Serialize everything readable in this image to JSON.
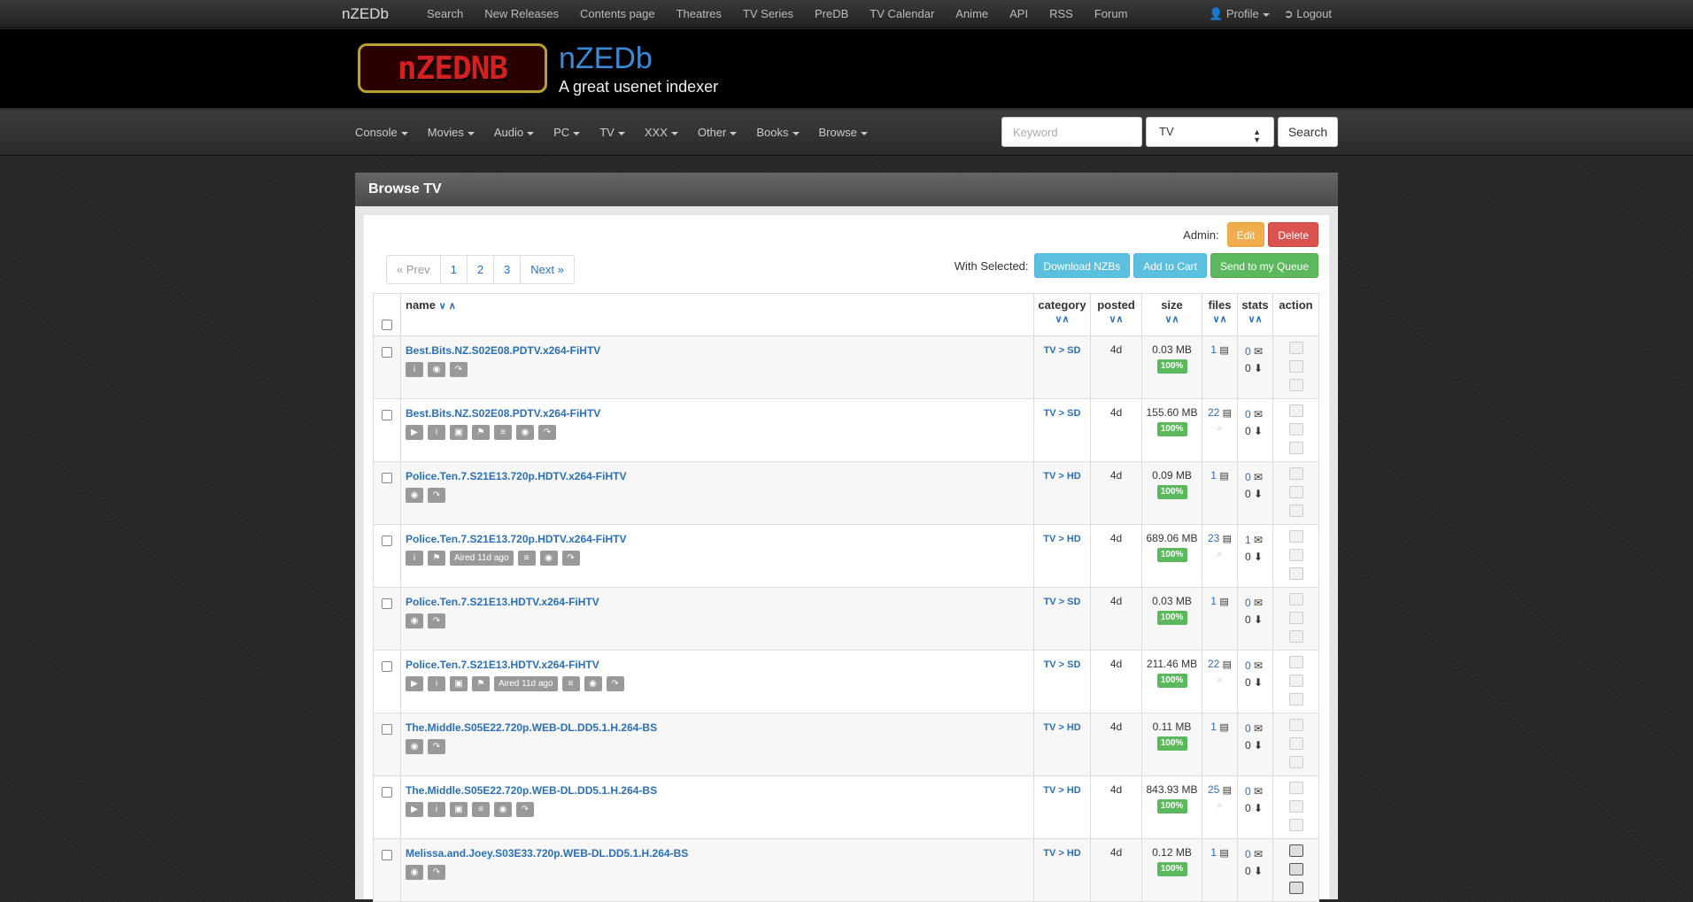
{
  "topnav": {
    "brand": "nZEDb",
    "links": [
      "Search",
      "New Releases",
      "Contents page",
      "Theatres",
      "TV Series",
      "PreDB",
      "TV Calendar",
      "Anime",
      "API",
      "RSS",
      "Forum"
    ],
    "profile": "Profile",
    "logout": "Logout"
  },
  "header": {
    "logo_text": "nZEDNB",
    "title": "nZEDb",
    "subtitle": "A great usenet indexer"
  },
  "catnav": {
    "items": [
      "Console",
      "Movies",
      "Audio",
      "PC",
      "TV",
      "XXX",
      "Other",
      "Books",
      "Browse"
    ],
    "search_placeholder": "Keyword",
    "search_category": "TV",
    "search_button": "Search"
  },
  "panel": {
    "title": "Browse TV",
    "admin_label": "Admin:",
    "edit_label": "Edit",
    "delete_label": "Delete",
    "with_selected_label": "With Selected:",
    "download_label": "Download NZBs",
    "cart_label": "Add to Cart",
    "queue_label": "Send to my Queue",
    "pager": {
      "prev": "« Prev",
      "pages": [
        "1",
        "2",
        "3"
      ],
      "next": "Next »"
    }
  },
  "table": {
    "headers": {
      "name": "name",
      "category": "category",
      "posted": "posted",
      "size": "size",
      "files": "files",
      "stats": "stats",
      "action": "action"
    },
    "rows": [
      {
        "title": "Best.Bits.NZ.S02E08.PDTV.x264-FiHTV",
        "category": "TV > SD",
        "posted": "4d",
        "size": "0.03 MB",
        "pct": "100%",
        "files": "1",
        "comments": "0",
        "grabs": "0",
        "icons": [
          "info-icon",
          "eye-icon",
          "share-icon"
        ],
        "aired": ""
      },
      {
        "title": "Best.Bits.NZ.S02E08.PDTV.x264-FiHTV",
        "category": "TV > SD",
        "posted": "4d",
        "size": "155.60 MB",
        "pct": "100%",
        "files": "22",
        "comments": "0",
        "grabs": "0",
        "icons": [
          "youtube-icon",
          "info-icon",
          "camera-icon",
          "bookmark-icon",
          "list-icon",
          "eye-icon",
          "share-icon"
        ],
        "aired": ""
      },
      {
        "title": "Police.Ten.7.S21E13.720p.HDTV.x264-FiHTV",
        "category": "TV > HD",
        "posted": "4d",
        "size": "0.09 MB",
        "pct": "100%",
        "files": "1",
        "comments": "0",
        "grabs": "0",
        "icons": [
          "eye-icon",
          "share-icon"
        ],
        "aired": ""
      },
      {
        "title": "Police.Ten.7.S21E13.720p.HDTV.x264-FiHTV",
        "category": "TV > HD",
        "posted": "4d",
        "size": "689.06 MB",
        "pct": "100%",
        "files": "23",
        "comments": "1",
        "grabs": "0",
        "icons": [
          "info-icon",
          "bookmark-icon",
          "aired",
          "list-icon",
          "eye-icon",
          "share-icon"
        ],
        "aired": "Aired 11d ago"
      },
      {
        "title": "Police.Ten.7.S21E13.HDTV.x264-FiHTV",
        "category": "TV > SD",
        "posted": "4d",
        "size": "0.03 MB",
        "pct": "100%",
        "files": "1",
        "comments": "0",
        "grabs": "0",
        "icons": [
          "eye-icon",
          "share-icon"
        ],
        "aired": ""
      },
      {
        "title": "Police.Ten.7.S21E13.HDTV.x264-FiHTV",
        "category": "TV > SD",
        "posted": "4d",
        "size": "211.46 MB",
        "pct": "100%",
        "files": "22",
        "comments": "0",
        "grabs": "0",
        "icons": [
          "youtube-icon",
          "info-icon",
          "camera-icon",
          "bookmark-icon",
          "aired",
          "list-icon",
          "eye-icon",
          "share-icon"
        ],
        "aired": "Aired 11d ago"
      },
      {
        "title": "The.Middle.S05E22.720p.WEB-DL.DD5.1.H.264-BS",
        "category": "TV > HD",
        "posted": "4d",
        "size": "0.11 MB",
        "pct": "100%",
        "files": "1",
        "comments": "0",
        "grabs": "0",
        "icons": [
          "eye-icon",
          "share-icon"
        ],
        "aired": ""
      },
      {
        "title": "The.Middle.S05E22.720p.WEB-DL.DD5.1.H.264-BS",
        "category": "TV > HD",
        "posted": "4d",
        "size": "843.93 MB",
        "pct": "100%",
        "files": "25",
        "comments": "0",
        "grabs": "0",
        "icons": [
          "youtube-icon",
          "info-icon",
          "camera-icon",
          "list-icon",
          "eye-icon",
          "share-icon"
        ],
        "aired": ""
      },
      {
        "title": "Melissa.and.Joey.S03E33.720p.WEB-DL.DD5.1.H.264-BS",
        "category": "TV > HD",
        "posted": "4d",
        "size": "0.12 MB",
        "pct": "100%",
        "files": "1",
        "comments": "0",
        "grabs": "0",
        "icons": [
          "eye-icon",
          "share-icon"
        ],
        "aired": ""
      }
    ]
  }
}
